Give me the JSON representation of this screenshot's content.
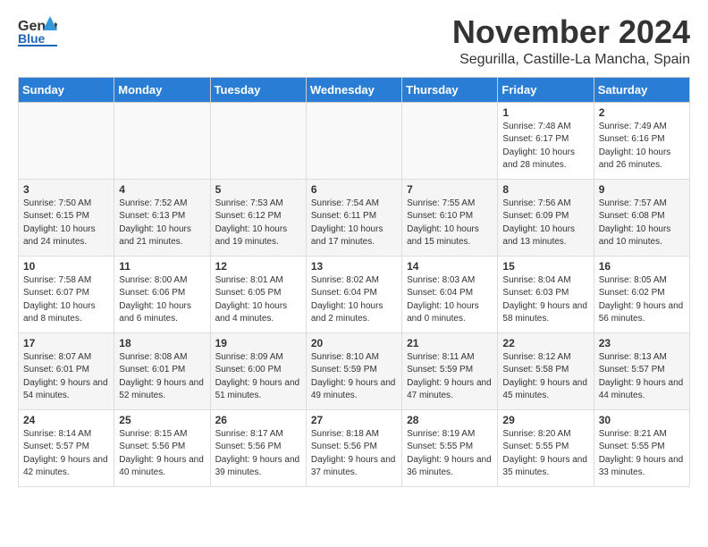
{
  "header": {
    "logo_general": "General",
    "logo_blue": "Blue",
    "month": "November 2024",
    "location": "Segurilla, Castille-La Mancha, Spain"
  },
  "weekdays": [
    "Sunday",
    "Monday",
    "Tuesday",
    "Wednesday",
    "Thursday",
    "Friday",
    "Saturday"
  ],
  "weeks": [
    [
      {
        "day": "",
        "info": ""
      },
      {
        "day": "",
        "info": ""
      },
      {
        "day": "",
        "info": ""
      },
      {
        "day": "",
        "info": ""
      },
      {
        "day": "",
        "info": ""
      },
      {
        "day": "1",
        "info": "Sunrise: 7:48 AM\nSunset: 6:17 PM\nDaylight: 10 hours\nand 28 minutes."
      },
      {
        "day": "2",
        "info": "Sunrise: 7:49 AM\nSunset: 6:16 PM\nDaylight: 10 hours\nand 26 minutes."
      }
    ],
    [
      {
        "day": "3",
        "info": "Sunrise: 7:50 AM\nSunset: 6:15 PM\nDaylight: 10 hours\nand 24 minutes."
      },
      {
        "day": "4",
        "info": "Sunrise: 7:52 AM\nSunset: 6:13 PM\nDaylight: 10 hours\nand 21 minutes."
      },
      {
        "day": "5",
        "info": "Sunrise: 7:53 AM\nSunset: 6:12 PM\nDaylight: 10 hours\nand 19 minutes."
      },
      {
        "day": "6",
        "info": "Sunrise: 7:54 AM\nSunset: 6:11 PM\nDaylight: 10 hours\nand 17 minutes."
      },
      {
        "day": "7",
        "info": "Sunrise: 7:55 AM\nSunset: 6:10 PM\nDaylight: 10 hours\nand 15 minutes."
      },
      {
        "day": "8",
        "info": "Sunrise: 7:56 AM\nSunset: 6:09 PM\nDaylight: 10 hours\nand 13 minutes."
      },
      {
        "day": "9",
        "info": "Sunrise: 7:57 AM\nSunset: 6:08 PM\nDaylight: 10 hours\nand 10 minutes."
      }
    ],
    [
      {
        "day": "10",
        "info": "Sunrise: 7:58 AM\nSunset: 6:07 PM\nDaylight: 10 hours\nand 8 minutes."
      },
      {
        "day": "11",
        "info": "Sunrise: 8:00 AM\nSunset: 6:06 PM\nDaylight: 10 hours\nand 6 minutes."
      },
      {
        "day": "12",
        "info": "Sunrise: 8:01 AM\nSunset: 6:05 PM\nDaylight: 10 hours\nand 4 minutes."
      },
      {
        "day": "13",
        "info": "Sunrise: 8:02 AM\nSunset: 6:04 PM\nDaylight: 10 hours\nand 2 minutes."
      },
      {
        "day": "14",
        "info": "Sunrise: 8:03 AM\nSunset: 6:04 PM\nDaylight: 10 hours\nand 0 minutes."
      },
      {
        "day": "15",
        "info": "Sunrise: 8:04 AM\nSunset: 6:03 PM\nDaylight: 9 hours\nand 58 minutes."
      },
      {
        "day": "16",
        "info": "Sunrise: 8:05 AM\nSunset: 6:02 PM\nDaylight: 9 hours\nand 56 minutes."
      }
    ],
    [
      {
        "day": "17",
        "info": "Sunrise: 8:07 AM\nSunset: 6:01 PM\nDaylight: 9 hours\nand 54 minutes."
      },
      {
        "day": "18",
        "info": "Sunrise: 8:08 AM\nSunset: 6:01 PM\nDaylight: 9 hours\nand 52 minutes."
      },
      {
        "day": "19",
        "info": "Sunrise: 8:09 AM\nSunset: 6:00 PM\nDaylight: 9 hours\nand 51 minutes."
      },
      {
        "day": "20",
        "info": "Sunrise: 8:10 AM\nSunset: 5:59 PM\nDaylight: 9 hours\nand 49 minutes."
      },
      {
        "day": "21",
        "info": "Sunrise: 8:11 AM\nSunset: 5:59 PM\nDaylight: 9 hours\nand 47 minutes."
      },
      {
        "day": "22",
        "info": "Sunrise: 8:12 AM\nSunset: 5:58 PM\nDaylight: 9 hours\nand 45 minutes."
      },
      {
        "day": "23",
        "info": "Sunrise: 8:13 AM\nSunset: 5:57 PM\nDaylight: 9 hours\nand 44 minutes."
      }
    ],
    [
      {
        "day": "24",
        "info": "Sunrise: 8:14 AM\nSunset: 5:57 PM\nDaylight: 9 hours\nand 42 minutes."
      },
      {
        "day": "25",
        "info": "Sunrise: 8:15 AM\nSunset: 5:56 PM\nDaylight: 9 hours\nand 40 minutes."
      },
      {
        "day": "26",
        "info": "Sunrise: 8:17 AM\nSunset: 5:56 PM\nDaylight: 9 hours\nand 39 minutes."
      },
      {
        "day": "27",
        "info": "Sunrise: 8:18 AM\nSunset: 5:56 PM\nDaylight: 9 hours\nand 37 minutes."
      },
      {
        "day": "28",
        "info": "Sunrise: 8:19 AM\nSunset: 5:55 PM\nDaylight: 9 hours\nand 36 minutes."
      },
      {
        "day": "29",
        "info": "Sunrise: 8:20 AM\nSunset: 5:55 PM\nDaylight: 9 hours\nand 35 minutes."
      },
      {
        "day": "30",
        "info": "Sunrise: 8:21 AM\nSunset: 5:55 PM\nDaylight: 9 hours\nand 33 minutes."
      }
    ]
  ]
}
